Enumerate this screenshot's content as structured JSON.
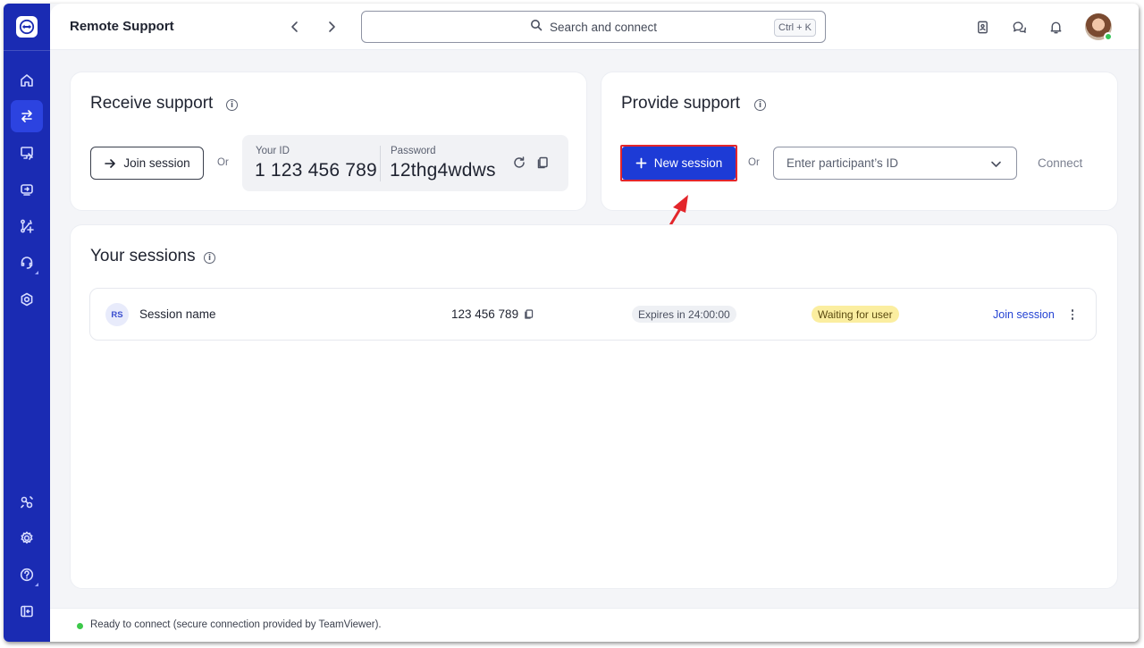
{
  "app": {
    "title": "Remote Support",
    "accent": "#1a2bb3",
    "primary": "#1d3bd6"
  },
  "sidebar": {
    "items": [
      {
        "name": "home",
        "icon": "home-icon"
      },
      {
        "name": "remote-support",
        "icon": "swap-arrows-icon",
        "active": true
      },
      {
        "name": "remote-devices",
        "icon": "device-cursor-icon"
      },
      {
        "name": "screen-share",
        "icon": "screen-share-icon"
      },
      {
        "name": "workflows",
        "icon": "workflow-icon"
      },
      {
        "name": "help-desk",
        "icon": "headset-icon"
      },
      {
        "name": "ar-assist",
        "icon": "hexagon-target-icon"
      },
      {
        "name": "integrations",
        "icon": "link-nodes-icon"
      },
      {
        "name": "settings",
        "icon": "gear-icon"
      },
      {
        "name": "help",
        "icon": "question-icon"
      },
      {
        "name": "collapse",
        "icon": "collapse-panel-icon"
      }
    ]
  },
  "topbar": {
    "search_placeholder": "Search and connect",
    "search_shortcut": "Ctrl + K"
  },
  "receive": {
    "title": "Receive support",
    "join_label": "Join session",
    "or_label": "Or",
    "your_id_label": "Your ID",
    "your_id_value": "1 123 456 789",
    "password_label": "Password",
    "password_value": "12thg4wdws"
  },
  "provide": {
    "title": "Provide support",
    "new_session_label": "New session",
    "or_label": "Or",
    "participant_placeholder": "Enter participant’s ID",
    "connect_label": "Connect"
  },
  "sessions": {
    "title": "Your sessions",
    "rows": [
      {
        "initials": "RS",
        "name": "Session name",
        "id": "123 456 789",
        "expires": "Expires in 24:00:00",
        "status": "Waiting for user",
        "action": "Join session"
      }
    ]
  },
  "status": {
    "text": "Ready to connect (secure connection provided by TeamViewer).",
    "color": "#3cc84a"
  }
}
